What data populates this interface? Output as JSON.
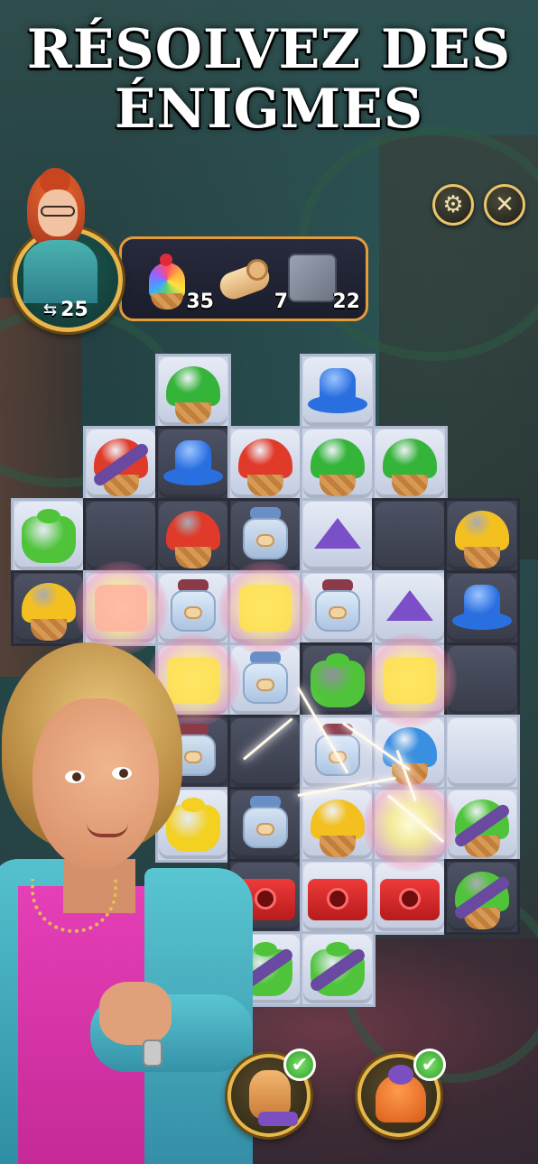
{
  "title": {
    "line1": "RÉSOLVEZ DES",
    "line2": "ÉNIGMES"
  },
  "header_buttons": {
    "settings_icon": "gear-icon",
    "close_icon": "close-icon",
    "settings_glyph": "⚙",
    "close_glyph": "✕"
  },
  "player": {
    "moves_icon": "swap-arrows-icon",
    "moves_glyph": "⇆",
    "moves_left": "25"
  },
  "goals": [
    {
      "item": "rainbow-cupcake",
      "count": "35"
    },
    {
      "item": "scroll",
      "count": "7"
    },
    {
      "item": "stone-tile",
      "count": "22"
    }
  ],
  "boosters": [
    {
      "item": "hand",
      "status": "checked",
      "check_glyph": "✔"
    },
    {
      "item": "bell",
      "status": "checked",
      "check_glyph": "✔"
    }
  ],
  "colors": {
    "gold": "#e8b64a",
    "panel_border": "#e59b3a",
    "title": "#ffffff"
  }
}
